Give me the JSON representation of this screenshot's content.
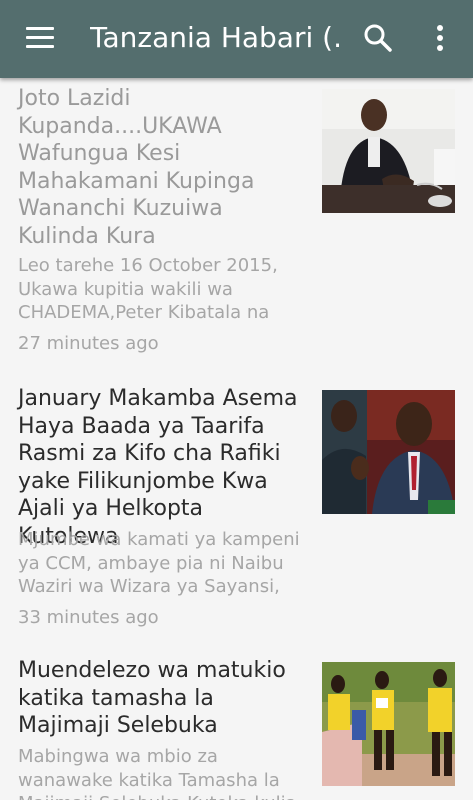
{
  "appbar": {
    "title": "Tanzania Habari (...",
    "menu_icon": "hamburger-menu-icon",
    "search_icon": "search-icon",
    "more_icon": "more-vert-icon",
    "bg": "#546e6e"
  },
  "articles": [
    {
      "headline": "Joto Lazidi Kupanda....UKAWA Wafungua Kesi Mahakamani Kupinga Wananchi Kuzuiwa Kulinda Kura",
      "snippet": "Leo tarehe 16 October 2015, Ukawa kupitia wakili wa CHADEMA,Peter Kibatala na",
      "time": "27 minutes ago",
      "read": true
    },
    {
      "headline": "January Makamba Asema Haya Baada ya Taarifa Rasmi za Kifo cha Rafiki yake Filikunjombe Kwa Ajali ya Helkopta Kutolewa",
      "snippet": "Mjumbe wa kamati ya kampeni ya CCM, ambaye pia ni Naibu Waziri wa Wizara ya Sayansi,",
      "time": "33 minutes ago",
      "read": false
    },
    {
      "headline": "Muendelezo wa matukio katika tamasha la Majimaji Selebuka",
      "snippet": "Mabingwa wa mbio za wanawake katika Tamasha la Majimaji Selebuka Kutoka kulia",
      "time": "",
      "read": false
    }
  ]
}
